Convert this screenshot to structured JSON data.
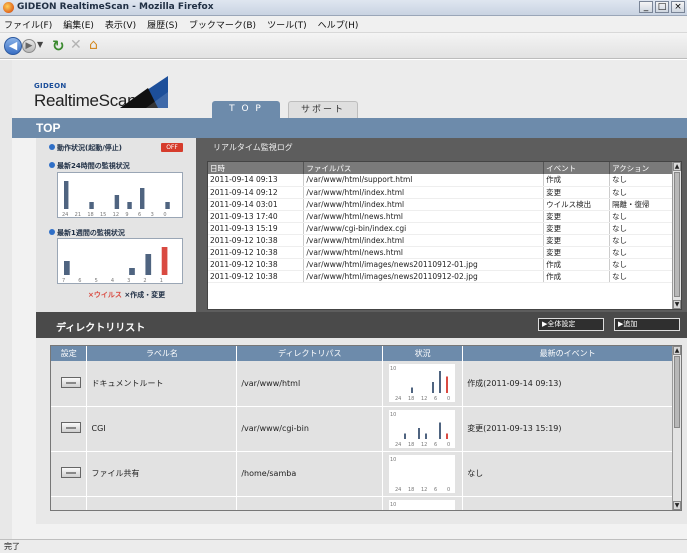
{
  "window": {
    "title": "GIDEON RealtimeScan - Mozilla Firefox",
    "controls": [
      "_",
      "□",
      "×"
    ]
  },
  "menu": [
    "ファイル(F)",
    "編集(E)",
    "表示(V)",
    "履歴(S)",
    "ブックマーク(B)",
    "ツール(T)",
    "ヘルプ(H)"
  ],
  "logo": {
    "brand": "GIDEON",
    "product": "RealtimeScan"
  },
  "tabs": {
    "top": "T O P",
    "support": "サポート"
  },
  "section_title": "TOP",
  "status": {
    "operation": "動作状況(起動/停止)",
    "off_label": "OFF",
    "day24": "最新24時間の監視状況",
    "week1": "最新1週間の監視状況",
    "legend_virus": "×ウイルス",
    "legend_change": "×作成・変更"
  },
  "chart_data": [
    {
      "type": "bar",
      "title": "最新24時間の監視状況",
      "categories": [
        "24",
        "21",
        "18",
        "15",
        "12",
        "9",
        "6",
        "3",
        "0"
      ],
      "values": [
        4,
        0,
        1,
        0,
        2,
        1,
        3,
        0,
        1
      ]
    },
    {
      "type": "bar",
      "title": "最新1週間の監視状況",
      "categories": [
        "7",
        "6",
        "5",
        "4",
        "3",
        "2",
        "1"
      ],
      "values": [
        4,
        0,
        0,
        0,
        2,
        6,
        8
      ],
      "highlight_index": 6
    }
  ],
  "log": {
    "title": "リアルタイム監視ログ",
    "columns": [
      "日時",
      "ファイルパス",
      "イベント",
      "アクション"
    ],
    "rows": [
      [
        "2011-09-14 09:13",
        "/var/www/html/support.html",
        "作成",
        "なし"
      ],
      [
        "2011-09-14 09:12",
        "/var/www/html/index.html",
        "変更",
        "なし"
      ],
      [
        "2011-09-14 03:01",
        "/var/www/html/index.html",
        "ウイルス検出",
        "隔離・復帰"
      ],
      [
        "2011-09-13 17:40",
        "/var/www/html/news.html",
        "変更",
        "なし"
      ],
      [
        "2011-09-13 15:19",
        "/var/www/cgi-bin/index.cgi",
        "変更",
        "なし"
      ],
      [
        "2011-09-12 10:38",
        "/var/www/html/index.html",
        "変更",
        "なし"
      ],
      [
        "2011-09-12 10:38",
        "/var/www/html/news.html",
        "変更",
        "なし"
      ],
      [
        "2011-09-12 10:38",
        "/var/www/html/images/news20110912-01.jpg",
        "作成",
        "なし"
      ],
      [
        "2011-09-12 10:38",
        "/var/www/html/images/news20110912-02.jpg",
        "作成",
        "なし"
      ]
    ]
  },
  "dirlist": {
    "title": "ディレクトリリスト",
    "btn_all_settings": "▶全体設定",
    "btn_add": "▶追加",
    "columns": [
      "設定",
      "ラベル名",
      "ディレクトリパス",
      "状況",
      "最新のイベント"
    ],
    "rows": [
      {
        "label": "ドキュメントルート",
        "path": "/var/www/html",
        "event": "作成(2011-09-14 09:13)",
        "spark": [
          0,
          0,
          1,
          0,
          0,
          2,
          4,
          3
        ]
      },
      {
        "label": "CGI",
        "path": "/var/www/cgi-bin",
        "event": "変更(2011-09-13 15:19)",
        "spark": [
          0,
          1,
          0,
          2,
          1,
          0,
          3,
          1
        ]
      },
      {
        "label": "ファイル共有",
        "path": "/home/samba",
        "event": "なし",
        "spark": [
          0,
          0,
          0,
          0,
          0,
          0,
          0,
          0
        ]
      },
      {
        "label": "",
        "path": "",
        "event": "",
        "spark": [
          0,
          0,
          0,
          0,
          0,
          0,
          0,
          0
        ]
      }
    ],
    "spark_ticks": [
      "24",
      "18",
      "12",
      "6",
      "0"
    ],
    "spark_max_label": "10"
  },
  "statusbar": "完了",
  "colors": {
    "accent": "#6d8bab",
    "dark": "#4a4a4a",
    "red": "#d63c2c"
  }
}
